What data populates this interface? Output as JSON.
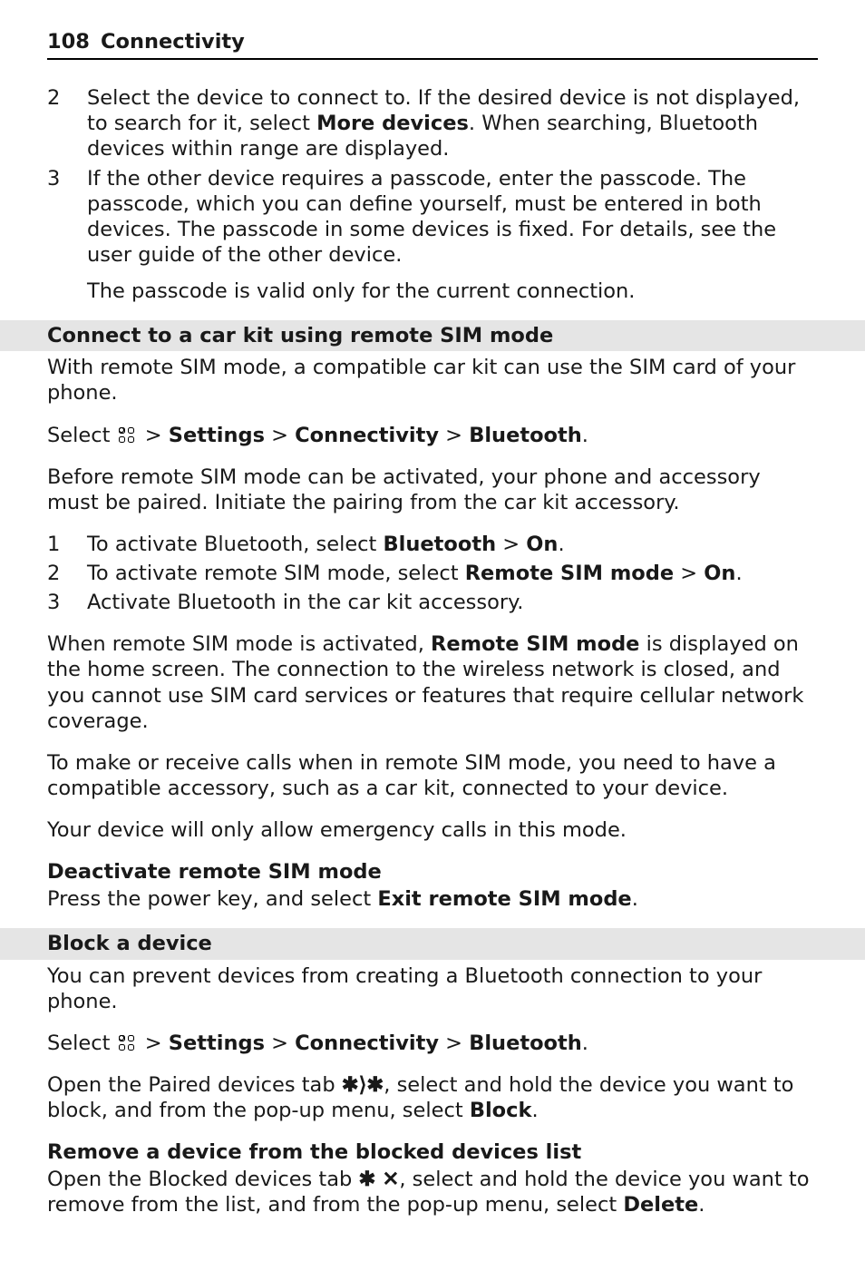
{
  "header": {
    "page_number": "108",
    "chapter": "Connectivity"
  },
  "step2": {
    "num": "2",
    "text_a": "Select the device to connect to. If the desired device is not displayed, to search for it, select ",
    "bold": "More devices",
    "text_b": ". When searching, Bluetooth devices within range are displayed."
  },
  "step3": {
    "num": "3",
    "line1": "If the other device requires a passcode, enter the passcode. The passcode, which you can define yourself, must be entered in both devices. The passcode in some devices is fixed. For details, see the user guide of the other device.",
    "line2": "The passcode is valid only for the current connection."
  },
  "sec1": {
    "title": "Connect to a car kit using remote SIM mode",
    "intro": "With remote SIM mode, a compatible car kit can use the SIM card of your phone.",
    "nav": {
      "select": "Select ",
      "s": "Settings",
      "c": "Connectivity",
      "b": "Bluetooth"
    },
    "pair": "Before remote SIM mode can be activated, your phone and accessory must be paired. Initiate the pairing from the car kit accessory.",
    "s1": {
      "num": "1",
      "a": "To activate Bluetooth, select ",
      "b1": "Bluetooth",
      "b2": "On",
      "sep": "  > "
    },
    "s2": {
      "num": "2",
      "a": "To activate remote SIM mode, select ",
      "b1": "Remote SIM mode",
      "b2": "On",
      "sep": "  > "
    },
    "s3": {
      "num": "3",
      "a": "Activate Bluetooth in the car kit accessory."
    },
    "p1a": "When remote SIM mode is activated, ",
    "p1b": "Remote SIM mode",
    "p1c": " is displayed on the home screen. The connection to the wireless network is closed, and you cannot use SIM card services or features that require cellular network coverage.",
    "p2": "To make or receive calls when in remote SIM mode, you need to have a compatible accessory, such as a car kit, connected to your device.",
    "p3": "Your device will only allow emergency calls in this mode.",
    "deact_h": "Deactivate remote SIM mode",
    "deact_a": "Press the power key, and select ",
    "deact_b": "Exit remote SIM mode",
    "deact_c": "."
  },
  "sec2": {
    "title": "Block a device",
    "intro": "You can prevent devices from creating a Bluetooth connection to your phone.",
    "nav": {
      "select": "Select ",
      "s": "Settings",
      "c": "Connectivity",
      "b": "Bluetooth"
    },
    "p1a": "Open the Paired devices tab ",
    "p1b": ", select and hold the device you want to block, and from the pop-up menu, select ",
    "p1c": "Block",
    "p1d": ".",
    "rm_h": "Remove a device from the blocked devices list",
    "rm_a": "Open the Blocked devices tab ",
    "rm_b": ", select and hold the device you want to remove from the list, and from the pop-up menu, select ",
    "rm_c": "Delete",
    "rm_d": "."
  },
  "glyph": {
    "gt": " > ",
    "dot": "."
  }
}
